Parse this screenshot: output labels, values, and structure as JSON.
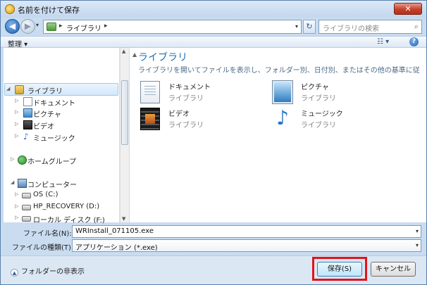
{
  "window": {
    "title": "名前を付けて保存",
    "close_label": "✕"
  },
  "nav": {
    "back_label": "◀",
    "forward_label": "▶",
    "history_label": "▾",
    "address_sep": "▸",
    "address_text": "ライブラリ",
    "address_drop": "▾",
    "refresh_label": "↻",
    "search_placeholder": "ライブラリの検索",
    "search_icon": "⌕"
  },
  "toolbar": {
    "organize_label": "整理 ▾",
    "view_label": "☷ ▾",
    "help_label": "?"
  },
  "tree": [
    {
      "label": "ライブラリ",
      "twisty": "◢",
      "icon": "library-icon"
    },
    {
      "label": "ドキュメント",
      "twisty": "▷",
      "icon": "documents-icon"
    },
    {
      "label": "ピクチャ",
      "twisty": "▷",
      "icon": "pictures-icon"
    },
    {
      "label": "ビデオ",
      "twisty": "▷",
      "icon": "videos-icon"
    },
    {
      "label": "ミュージック",
      "twisty": "▷",
      "icon": "music-icon"
    },
    {
      "label": "ホームグループ",
      "twisty": "▷",
      "icon": "homegroup-icon"
    },
    {
      "label": "コンピューター",
      "twisty": "◢",
      "icon": "computer-icon"
    },
    {
      "label": "OS (C:)",
      "twisty": "▷",
      "icon": "drive-icon"
    },
    {
      "label": "HP_RECOVERY (D:)",
      "twisty": "▷",
      "icon": "drive-icon"
    },
    {
      "label": "ローカル ディスク (F:)",
      "twisty": "▷",
      "icon": "drive-icon"
    }
  ],
  "scroll": {
    "up": "▲",
    "down": "▼"
  },
  "content": {
    "title": "ライブラリ",
    "description": "ライブラリを開いてファイルを表示し、フォルダー別、日付別、またはその他の基準に従って...",
    "up_arrow": "▲",
    "items": [
      {
        "name": "ドキュメント",
        "sub": "ライブラリ",
        "icon": "documents-icon"
      },
      {
        "name": "ピクチャ",
        "sub": "ライブラリ",
        "icon": "pictures-icon"
      },
      {
        "name": "ビデオ",
        "sub": "ライブラリ",
        "icon": "videos-icon"
      },
      {
        "name": "ミュージック",
        "sub": "ライブラリ",
        "icon": "music-icon"
      }
    ],
    "music_glyph": "♪"
  },
  "form": {
    "filename_label": "ファイル名(N):",
    "filename_value": "WRInstall_071105.exe",
    "filetype_label": "ファイルの種類(T):",
    "filetype_value": "アプリケーション (*.exe)",
    "drop": "▾"
  },
  "footer": {
    "hide_folders_label": "フォルダーの非表示",
    "hide_chev": "▲",
    "save_label": "保存(S)",
    "cancel_label": "キャンセル"
  },
  "colors": {
    "accent": "#1e6fb8",
    "highlight": "#e0141c"
  }
}
